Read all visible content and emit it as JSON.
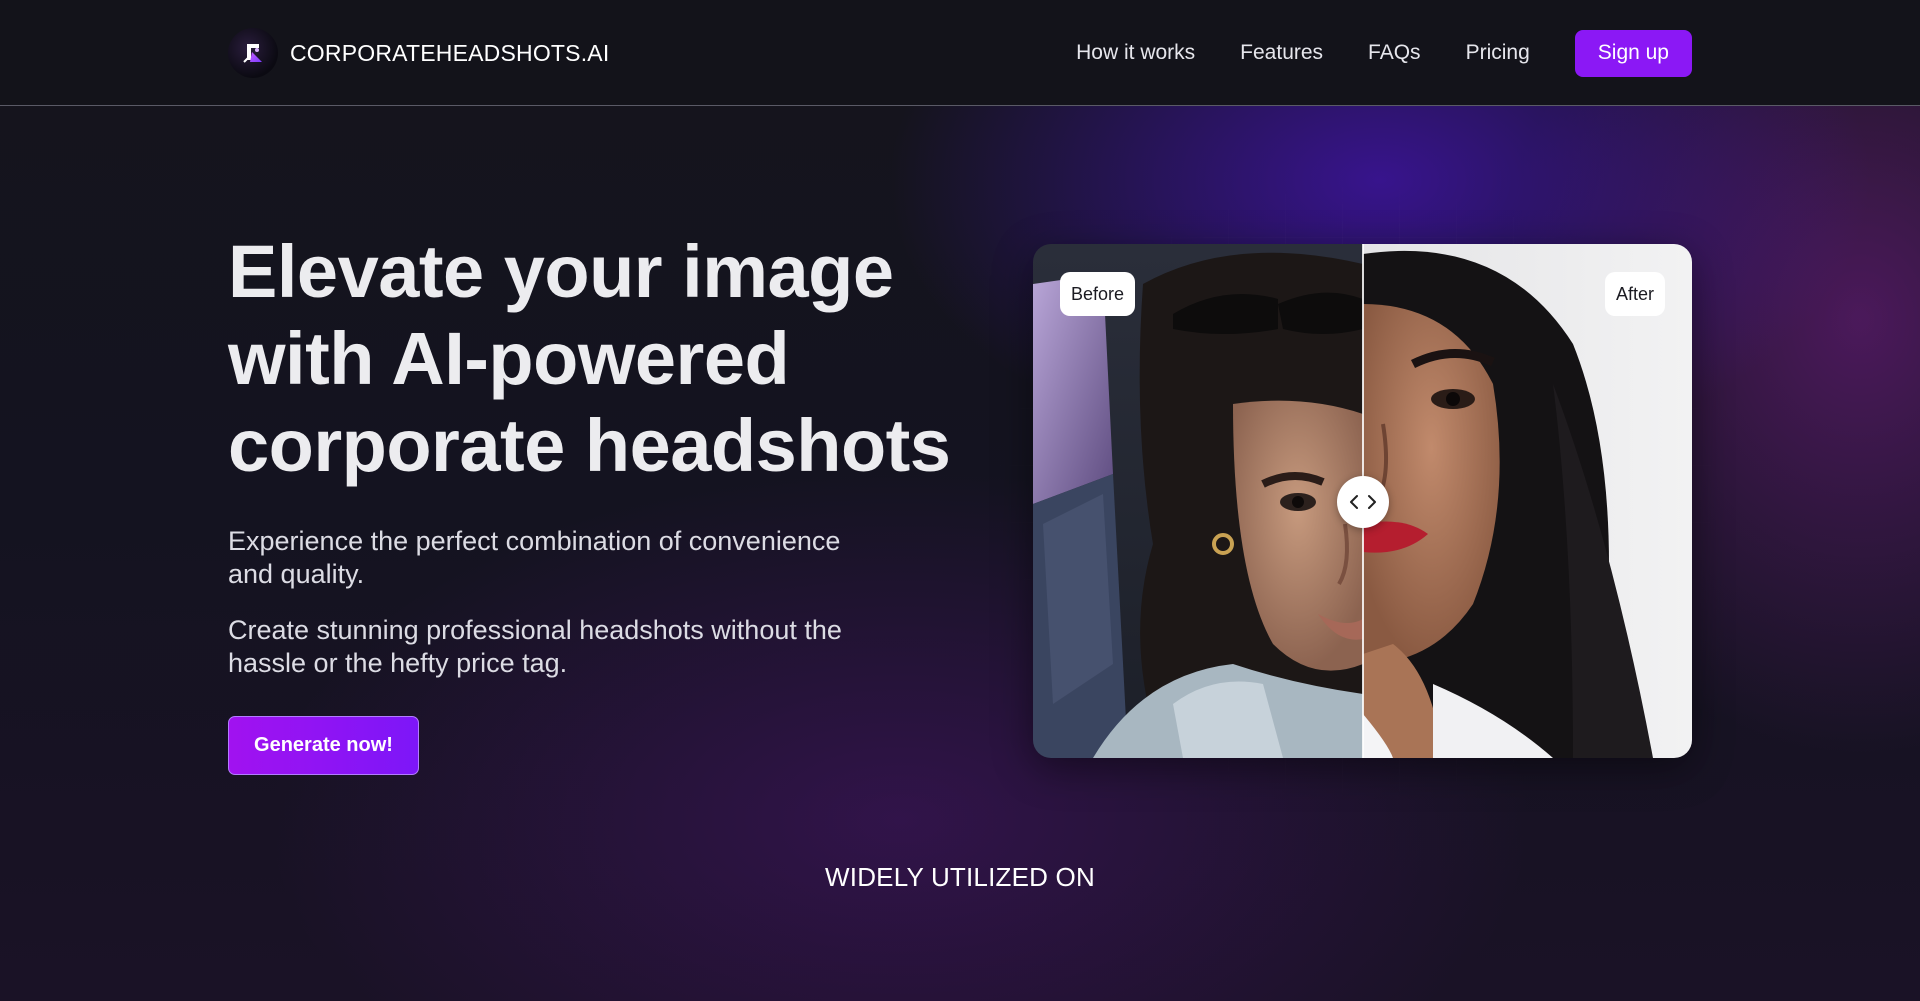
{
  "brand": {
    "name": "CORPORATEHEADSHOTS.AI",
    "logo_icon": "sparkle-frame-logo"
  },
  "nav": {
    "links": [
      "How it works",
      "Features",
      "FAQs",
      "Pricing"
    ],
    "signup_label": "Sign up"
  },
  "hero": {
    "title_lines": [
      "Elevate your image",
      "with AI-powered",
      "corporate headshots"
    ],
    "subtitle_1": "Experience the perfect combination of convenience and quality.",
    "subtitle_2": "Create stunning professional headshots without the hassle or the hefty price tag.",
    "cta_label": "Generate now!"
  },
  "comparison": {
    "before_label": "Before",
    "after_label": "After",
    "slider_position": 0.5,
    "handle_icon": "chevron-left-right-icon"
  },
  "logos_section": {
    "heading": "WIDELY UTILIZED ON"
  },
  "colors": {
    "accent": "#8b18f5",
    "background": "#13131a",
    "text": "#ececef"
  }
}
